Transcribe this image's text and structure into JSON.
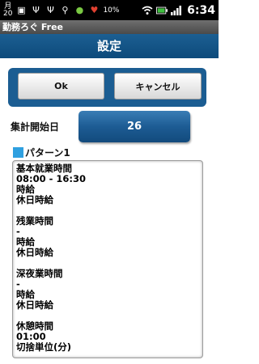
{
  "status_bar": {
    "date_month": "月",
    "date_day": "20",
    "battery_percent": "10%",
    "time": "6:34"
  },
  "app": {
    "title": "勤務ろぐ Free"
  },
  "header": {
    "title": "設定"
  },
  "buttons": {
    "ok_label": "Ok",
    "cancel_label": "キャンセル"
  },
  "settings": {
    "start_day_label": "集計開始日",
    "start_day_value": "26",
    "pattern_label": "パターン1"
  },
  "pattern_details": {
    "lines": [
      "基本就業時間",
      "08:00 - 16:30",
      "時給",
      "休日時給",
      "",
      "残業時間",
      "-",
      "時給",
      "休日時給",
      "",
      "深夜業時間",
      "-",
      "時給",
      "休日時給",
      "",
      "休憩時間",
      "01:00",
      "切捨単位(分)"
    ]
  },
  "colors": {
    "header_blue": "#0d4a7b",
    "pattern_square": "#2fa0e0"
  }
}
